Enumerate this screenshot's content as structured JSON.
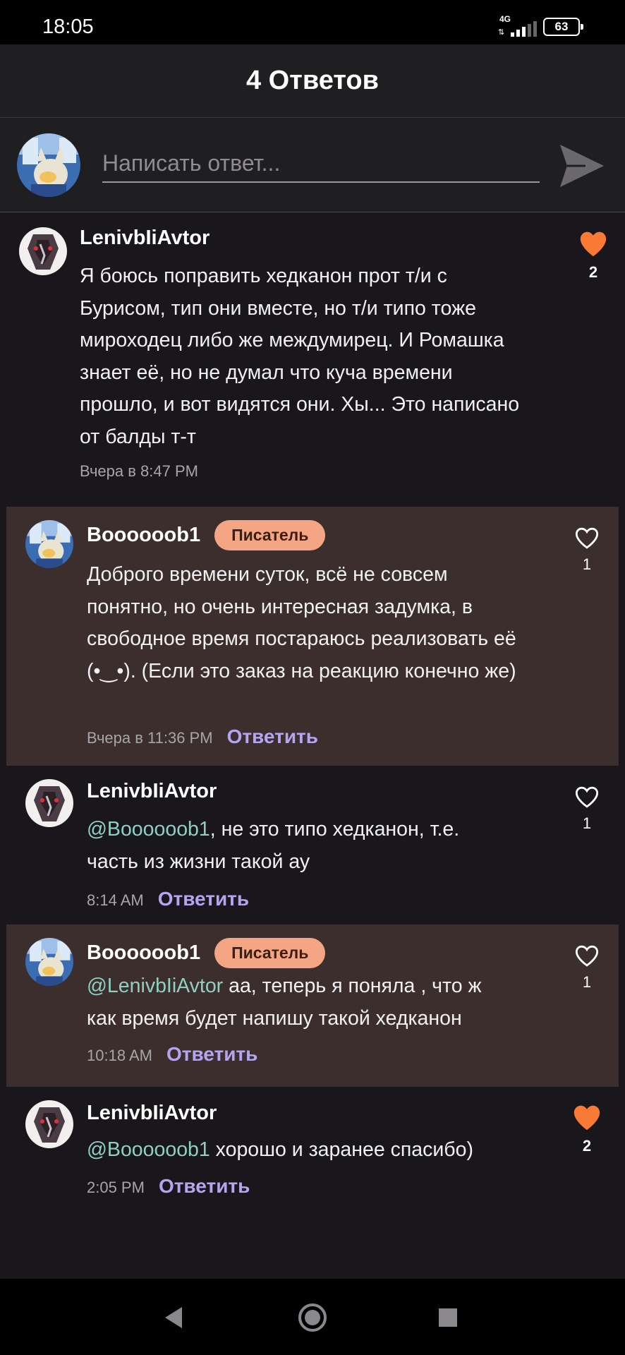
{
  "status_bar": {
    "time": "18:05",
    "network": "4G",
    "battery": "63"
  },
  "header": {
    "title": "4 Ответов"
  },
  "composer": {
    "placeholder": "Написать ответ...",
    "send_icon": "send-icon"
  },
  "colors": {
    "accent_like": "#f97a35",
    "badge": "#f4a684",
    "reply_link": "#b4a5f0",
    "mention": "#8fd0c2",
    "highlight_bg": "#3b2e2c"
  },
  "comments": [
    {
      "author": "LenivbIiAvtor",
      "text": "Я боюсь поправить хедканон прот т/и с Бурисом, тип они вместе, но т/и типо тоже мироходец либо же междумирец. И Ромашка знает её, но не думал что куча времени прошло, и вот видятся они. Хы... Это написано от балды т-т",
      "time": "Вчера в 8:47 PM",
      "likes": "2",
      "liked": true
    },
    {
      "author": "Boooooob1",
      "badge": "Писатель",
      "text": "Доброго времени суток, всё не совсем понятно, но очень интересная задумка, в свободное время постараюсь реализовать её (•‿•).     (Если это заказ на реакцию конечно же)",
      "time": "Вчера в 11:36 PM",
      "reply_label": "Ответить",
      "likes": "1",
      "liked": false
    },
    {
      "author": "LenivbIiAvtor",
      "mention": "@Boooooob1",
      "text": ", не это типо хедканон, т.е. часть из жизни такой ау",
      "time": "8:14 AM",
      "reply_label": "Ответить",
      "likes": "1",
      "liked": false
    },
    {
      "author": "Boooooob1",
      "badge": "Писатель",
      "mention": "@LenivbIiAvtor",
      "text": " аа, теперь я поняла , что ж как время будет напишу такой хедканон",
      "time": "10:18 AM",
      "reply_label": "Ответить",
      "likes": "1",
      "liked": false
    },
    {
      "author": "LenivbIiAvtor",
      "mention": "@Boooooob1",
      "text": " хорошо и заранее спасибо)",
      "time": "2:05 PM",
      "reply_label": "Ответить",
      "likes": "2",
      "liked": true
    }
  ]
}
